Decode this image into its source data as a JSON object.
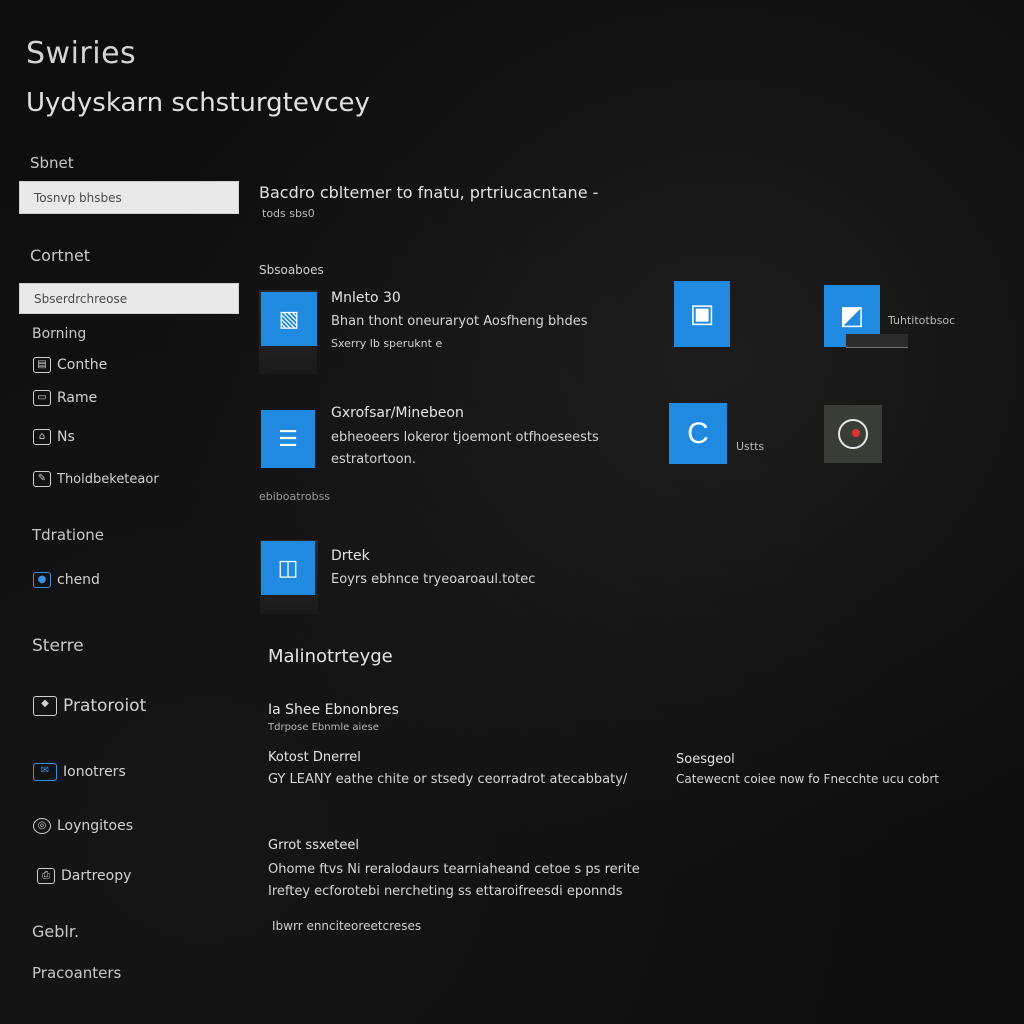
{
  "window": {
    "app_title": "Swiries",
    "heading": "Uydyskarn schsturgtevcey"
  },
  "sidebar": {
    "search_label": "Sbnet",
    "search_value": "Tosnvp bhsbes",
    "group1_label": "Cortnet",
    "group1_value": "Sbserdrchreose",
    "group2_label": "Borning",
    "items_a": [
      {
        "label": "Conthe",
        "icon": "document-icon"
      },
      {
        "label": "Rame",
        "icon": "folder-icon"
      },
      {
        "label": "Ns",
        "icon": "home-icon"
      },
      {
        "label": "Tholdbeketeaor",
        "icon": "tools-icon"
      }
    ],
    "group3_label": "Tdratione",
    "items_b": [
      {
        "label": "chend",
        "icon": "account-icon"
      }
    ],
    "group4_label": "Sterre",
    "items_c": [
      {
        "label": "Pratoroiot",
        "icon": "gallery-icon"
      },
      {
        "label": "Ionotrers",
        "icon": "mail-icon"
      },
      {
        "label": "Loyngitoes",
        "icon": "globe-icon"
      },
      {
        "label": "Dartreopy",
        "icon": "printer-icon"
      }
    ],
    "group5_label": "Geblr.",
    "group6_label": "Pracoanters"
  },
  "main": {
    "header_title": "Bacdro cbltemer to fnatu, prtriucacntane -",
    "header_sub": "tods sbs0",
    "section1_label": "Sbsoaboes",
    "apps": [
      {
        "title": "Mnleto 30",
        "desc": "Bhan thont oneuraryot Aosfheng bhdes",
        "sub": "Sxerry lb speruknt e"
      },
      {
        "title": "Gxrofsar/Minebeon",
        "desc": "ebheoeers lokeror tjoemont otfhoeseests",
        "sub": "estratortoon."
      },
      {
        "title": "Drtek",
        "desc": "Eoyrs ebhnce tryeoaroaul.totec",
        "sub": ""
      }
    ],
    "section1_footer": "ebiboatrobss",
    "side_tiles": [
      {
        "label": "",
        "glyph": "▣",
        "icon": "notepad-icon"
      },
      {
        "label": "Tuhtitotbsoc",
        "glyph": "◩",
        "icon": "display-icon"
      },
      {
        "label": "Ustts",
        "glyph": "C",
        "icon": "c-app-icon"
      },
      {
        "label": "",
        "glyph": "◉",
        "icon": "gauge-icon"
      }
    ],
    "section2_title": "Malinotrteyge",
    "section2_sub1": "Ia Shee Ebnonbres",
    "section2_sub1_small": "Tdrpose Ebnmle aiese",
    "col1_title": "Kotost Dnerrel",
    "col1_text": "GY LEANY eathe chite or stsedy ceorradrot atecabbaty/",
    "col2_title": "Soesgeol",
    "col2_text": "Catewecnt coiee now fo Fnecchte ucu cobrt",
    "section3_title": "Grrot ssxeteel",
    "section3_line1": "Ohome ftvs Ni reralodaurs tearniaheand cetoe s ps rerite",
    "section3_line2": "Ireftey ecforotebi nercheting ss ettaroifreesdi eponnds",
    "section3_link": "Ibwrr ennciteoreetcreses"
  },
  "colors": {
    "background": "#0e0e0e",
    "accent": "#1f8ae0",
    "field": "#e9e9e9"
  }
}
